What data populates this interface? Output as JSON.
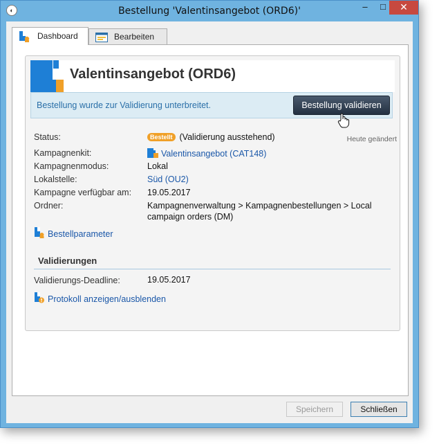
{
  "window": {
    "title": "Bestellung 'Valentinsangebot  (ORD6)'",
    "controls": {
      "minimize": "–",
      "maximize": "□",
      "close": "✕"
    }
  },
  "tabs": [
    {
      "label": "Dashboard",
      "icon": "order-icon",
      "active": true
    },
    {
      "label": "Bearbeiten",
      "icon": "form-icon",
      "active": false
    }
  ],
  "header": {
    "title": "Valentinsangebot (ORD6)"
  },
  "notice": {
    "text": "Bestellung wurde zur Validierung unterbreitet.",
    "button": "Bestellung validieren"
  },
  "fields": {
    "status_label": "Status:",
    "status_badge": "Bestellt",
    "status_value": "(Validierung ausstehend)",
    "modified": "Heute geändert",
    "kit_label": "Kampagnenkit:",
    "kit_value": "Valentinsangebot (CAT148)",
    "mode_label": "Kampagnenmodus:",
    "mode_value": "Lokal",
    "entity_label": "Lokalstelle:",
    "entity_value": "Süd (OU2)",
    "available_label": "Kampagne verfügbar am:",
    "available_value": "19.05.2017",
    "folder_label": "Ordner:",
    "folder_value_line1": "Kampagnenverwaltung > Kampagnenbestellungen > Local",
    "folder_value_line2": "campaign orders (DM)"
  },
  "links": {
    "order_params": "Bestellparameter",
    "toggle_log": "Protokoll anzeigen/ausblenden"
  },
  "validations": {
    "title": "Validierungen",
    "deadline_label": "Validierungs-Deadline:",
    "deadline_value": "19.05.2017"
  },
  "footer": {
    "save": "Speichern",
    "close": "Schließen"
  },
  "colors": {
    "accent": "#1e7fd6",
    "badge": "#f0a028",
    "link": "#1a57a8",
    "window_frame": "#6fb3e0"
  }
}
